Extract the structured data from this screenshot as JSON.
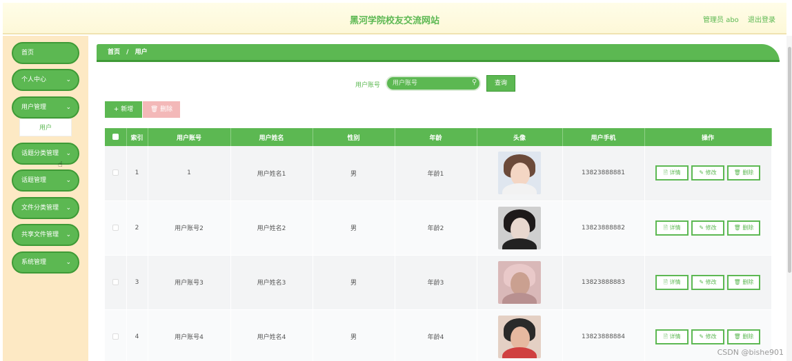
{
  "header": {
    "title": "黑河学院校友交流网站",
    "user": "管理员 abo",
    "logout": "退出登录"
  },
  "sidebar": {
    "items": [
      {
        "label": "首页",
        "has_children": false
      },
      {
        "label": "个人中心",
        "has_children": true
      },
      {
        "label": "用户管理",
        "has_children": true
      },
      {
        "label": "话题分类管理",
        "has_children": true
      },
      {
        "label": "话题管理",
        "has_children": true
      },
      {
        "label": "文件分类管理",
        "has_children": true
      },
      {
        "label": "共享文件管理",
        "has_children": true
      },
      {
        "label": "系统管理",
        "has_children": true
      }
    ],
    "submenu": {
      "label": "用户"
    }
  },
  "breadcrumb": {
    "home": "首页",
    "separator": "/",
    "current": "用户"
  },
  "search": {
    "label": "用户账号",
    "placeholder": "用户账号",
    "button": "查询"
  },
  "actions": {
    "add": "+ 新增",
    "delete": "🗑 删除"
  },
  "table": {
    "columns": [
      "",
      "索引",
      "用户账号",
      "用户姓名",
      "性别",
      "年龄",
      "头像",
      "用户手机",
      "操作"
    ],
    "rows": [
      {
        "index": "1",
        "account": "1",
        "name": "用户姓名1",
        "gender": "男",
        "age": "年龄1",
        "phone": "13823888881"
      },
      {
        "index": "2",
        "account": "用户账号2",
        "name": "用户姓名2",
        "gender": "男",
        "age": "年龄2",
        "phone": "13823888882"
      },
      {
        "index": "3",
        "account": "用户账号3",
        "name": "用户姓名3",
        "gender": "男",
        "age": "年龄3",
        "phone": "13823888883"
      },
      {
        "index": "4",
        "account": "用户账号4",
        "name": "用户姓名4",
        "gender": "男",
        "age": "年龄4",
        "phone": "13823888884"
      }
    ],
    "row_buttons": {
      "detail": "🗎 详情",
      "edit": "✎ 修改",
      "delete": "🗑 删除"
    }
  },
  "watermark": "CSDN @bishe901",
  "colors": {
    "primary": "#5cb852",
    "primary_dark": "#3e9a36",
    "sidebar_bg": "#fde9c4",
    "danger_light": "#f3b8b8"
  }
}
